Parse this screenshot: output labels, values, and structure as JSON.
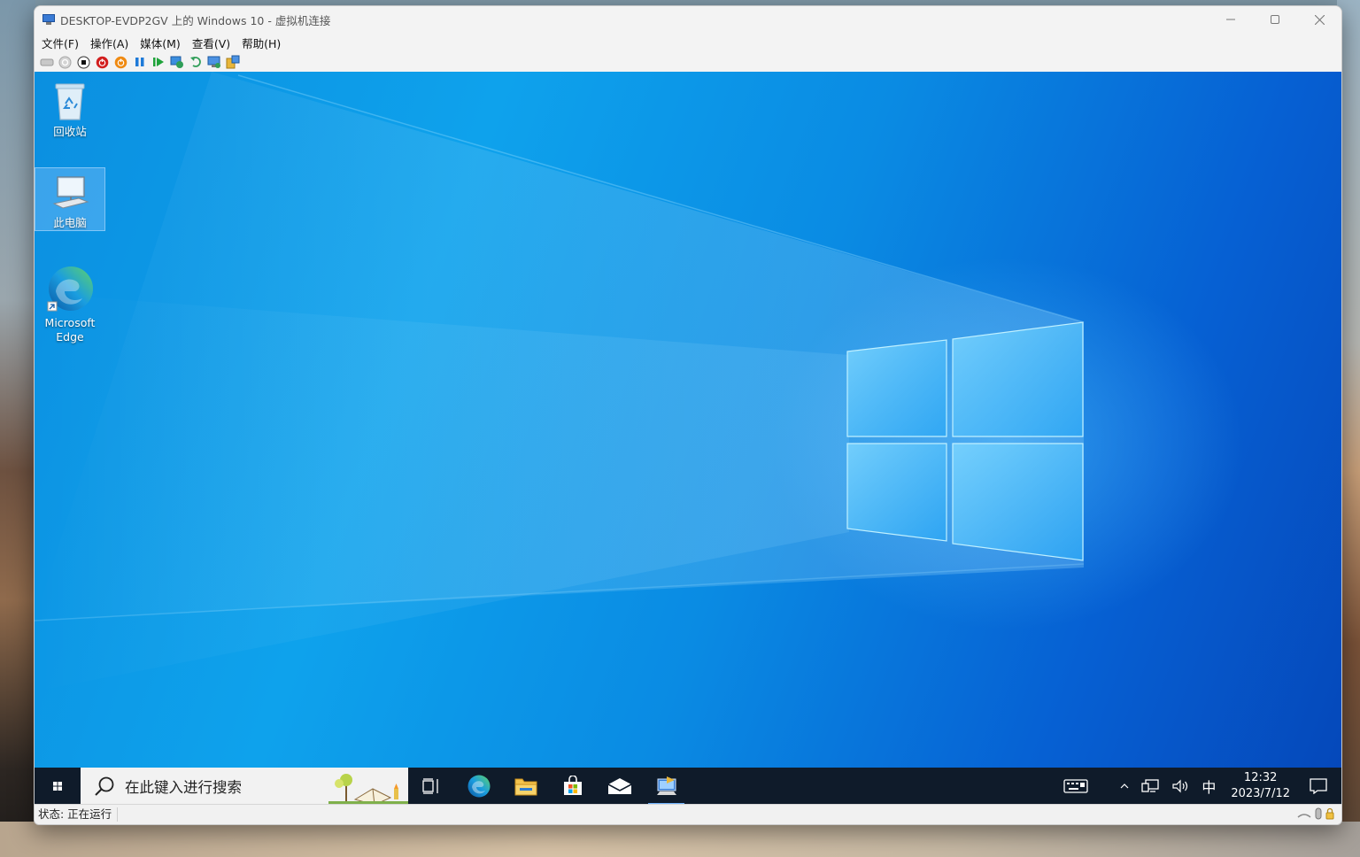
{
  "window": {
    "title": "DESKTOP-EVDP2GV 上的 Windows 10 - 虚拟机连接",
    "minimize_icon": "minimize-icon",
    "maximize_icon": "maximize-icon",
    "close_icon": "close-icon"
  },
  "menu": {
    "items": [
      "文件(F)",
      "操作(A)",
      "媒体(M)",
      "查看(V)",
      "帮助(H)"
    ]
  },
  "toolbar": {
    "buttons": [
      {
        "icon": "ctrl-alt-del-icon",
        "color": "#b9b9b9"
      },
      {
        "icon": "start-icon",
        "color": "#b9b9b9"
      },
      {
        "icon": "turn-off-icon",
        "color": "#111111"
      },
      {
        "icon": "shutdown-icon",
        "color": "#d21e1e"
      },
      {
        "icon": "save-icon",
        "color": "#ef8a12"
      },
      {
        "icon": "pause-icon",
        "color": "#1e7ad8"
      },
      {
        "icon": "resume-icon",
        "color": "#1fa33a"
      },
      {
        "icon": "checkpoint-icon",
        "color": "#2f9e58"
      },
      {
        "icon": "revert-icon",
        "color": "#2f9e58"
      },
      {
        "icon": "enhanced-session-icon",
        "color": "#2d6fd1"
      },
      {
        "icon": "share-icon",
        "color": "#e8b63a"
      }
    ]
  },
  "desktop": {
    "icons": [
      {
        "label": "回收站",
        "icon": "recycle-bin-icon"
      },
      {
        "label": "此电脑",
        "icon": "this-pc-icon"
      },
      {
        "label": "Microsoft\nEdge",
        "label_line1": "Microsoft",
        "label_line2": "Edge",
        "icon": "edge-icon"
      }
    ]
  },
  "taskbar": {
    "search_placeholder": "在此键入进行搜索",
    "apps": [
      "task-view-icon",
      "edge-icon",
      "file-explorer-icon",
      "store-icon",
      "mail-icon",
      "vm-connection-icon"
    ],
    "tray": {
      "ime_mode": "中",
      "time": "12:32",
      "date": "2023/7/12"
    }
  },
  "statusbar": {
    "status": "状态: 正在运行"
  },
  "colors": {
    "accent": "#0078d7",
    "taskbar_bg": "#0f1b2a"
  }
}
